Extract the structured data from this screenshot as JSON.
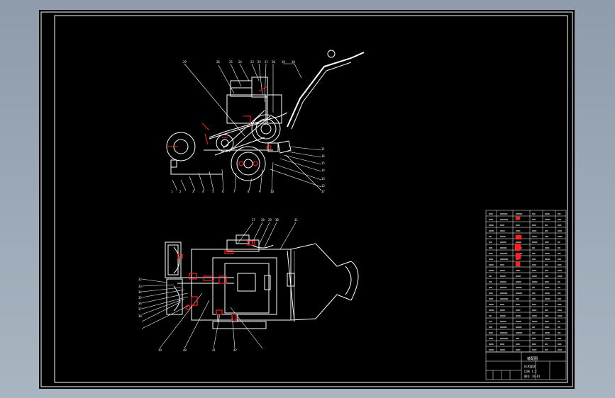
{
  "drawing": {
    "background_color": "#000000",
    "workspace_color": "#9aa8b6",
    "line_color": "#ffffff",
    "highlight_color": "#ff2020",
    "front_view_callouts": [
      "29",
      "26",
      "25",
      "24",
      "23",
      "22",
      "21",
      "20",
      "19",
      "18",
      "11",
      "16",
      "15",
      "14",
      "13",
      "12",
      "17",
      "1",
      "2",
      "3",
      "4",
      "5",
      "6",
      "7",
      "8",
      "9",
      "10"
    ],
    "top_view_callouts": [
      "27",
      "28",
      "29",
      "30",
      "31",
      "32",
      "33",
      "34",
      "35",
      "36",
      "37",
      "38",
      "39",
      "40",
      "41",
      "42"
    ],
    "title_block": {
      "drawing_name": "装配图",
      "notes": [
        "技术要求",
        "比例 1:2",
        "图号 JX-01"
      ]
    }
  }
}
